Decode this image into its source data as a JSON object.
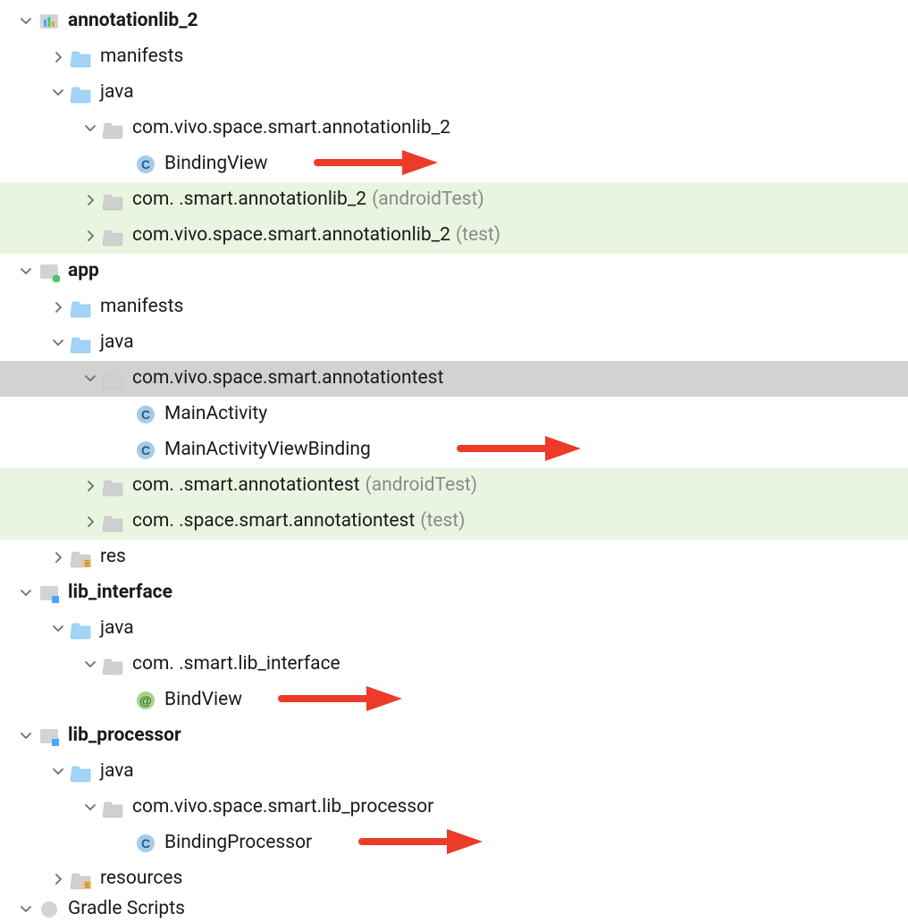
{
  "tree": {
    "module_annotationlib": {
      "name": "annotationlib_2",
      "manifests": "manifests",
      "java": "java",
      "pkg_main": "com.vivo.space.smart.annotationlib_2",
      "class_BindingView": "BindingView",
      "pkg_androidTest": "com.       .smart.annotationlib_2",
      "pkg_androidTest_suffix": "(androidTest)",
      "pkg_test": "com.vivo.space.smart.annotationlib_2",
      "pkg_test_suffix": "(test)"
    },
    "module_app": {
      "name": "app",
      "manifests": "manifests",
      "java": "java",
      "pkg_main": "com.vivo.space.smart.annotationtest",
      "class_MainActivity": "MainActivity",
      "class_MainActivityViewBinding": "MainActivityViewBinding",
      "pkg_androidTest": "com.          .smart.annotationtest",
      "pkg_androidTest_suffix": "(androidTest)",
      "pkg_test": "com.     .space.smart.annotationtest",
      "pkg_test_suffix": "(test)",
      "res": "res"
    },
    "module_lib_interface": {
      "name": "lib_interface",
      "java": "java",
      "pkg_main": "com.          .smart.lib_interface",
      "anno_BindView": "BindView"
    },
    "module_lib_processor": {
      "name": "lib_processor",
      "java": "java",
      "pkg_main": "com.vivo.space.smart.lib_processor",
      "class_BindingProcessor": "BindingProcessor",
      "resources": "resources"
    },
    "gradle_scripts": "Gradle Scripts"
  }
}
